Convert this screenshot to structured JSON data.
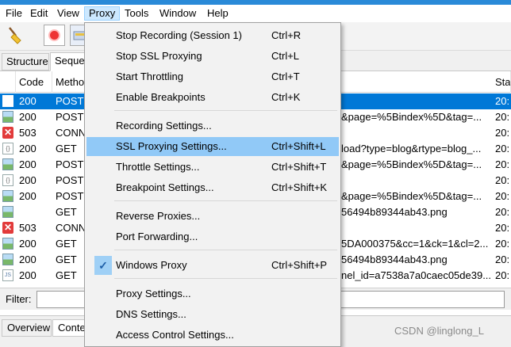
{
  "menubar": [
    "File",
    "Edit",
    "View",
    "Proxy",
    "Tools",
    "Window",
    "Help"
  ],
  "tabs": {
    "structure": "Structure",
    "sequence": "Sequence"
  },
  "columns": {
    "code": "Code",
    "method": "Method",
    "start": "Start"
  },
  "rows": [
    {
      "icon": "document-icon",
      "code": "200",
      "method": "POST",
      "url": "",
      "start": "20:",
      "selected": true
    },
    {
      "icon": "image-icon",
      "code": "200",
      "method": "POST",
      "url": "&page=%5Bindex%5D&tag=...",
      "start": "20:"
    },
    {
      "icon": "error-icon",
      "code": "503",
      "method": "CONNECT",
      "url": "",
      "start": "20:"
    },
    {
      "icon": "json-icon",
      "code": "200",
      "method": "GET",
      "url": "load?type=blog&rtype=blog_...",
      "start": "20:"
    },
    {
      "icon": "image-icon",
      "code": "200",
      "method": "POST",
      "url": "&page=%5Bindex%5D&tag=...",
      "start": "20:"
    },
    {
      "icon": "json-icon",
      "code": "200",
      "method": "POST",
      "url": "",
      "start": "20:"
    },
    {
      "icon": "image-icon",
      "code": "200",
      "method": "POST",
      "url": "&page=%5Bindex%5D&tag=...",
      "start": "20:"
    },
    {
      "icon": "image-icon",
      "code": "",
      "method": "GET",
      "url": "56494b89344ab43.png",
      "start": "20:"
    },
    {
      "icon": "error-icon",
      "code": "503",
      "method": "CONNECT",
      "url": "",
      "start": "20:"
    },
    {
      "icon": "image-icon",
      "code": "200",
      "method": "GET",
      "url": "5DA000375&cc=1&ck=1&cl=2...",
      "start": "20:"
    },
    {
      "icon": "image-icon",
      "code": "200",
      "method": "GET",
      "url": "56494b89344ab43.png",
      "start": "20:"
    },
    {
      "icon": "js-icon",
      "code": "200",
      "method": "GET",
      "url": "nel_id=a7538a7a0caec05de39...",
      "start": "20:"
    }
  ],
  "filter": {
    "label": "Filter:"
  },
  "bottom_tabs": {
    "overview": "Overview",
    "contents": "Contents"
  },
  "watermark": "CSDN @linglong_L",
  "proxy_menu": [
    {
      "label": "Stop Recording (Session 1)",
      "shortcut": "Ctrl+R"
    },
    {
      "label": "Stop SSL Proxying",
      "shortcut": "Ctrl+L"
    },
    {
      "label": "Start Throttling",
      "shortcut": "Ctrl+T"
    },
    {
      "label": "Enable Breakpoints",
      "shortcut": "Ctrl+K"
    },
    {
      "label": "Recording Settings...",
      "shortcut": ""
    },
    {
      "label": "SSL Proxying Settings...",
      "shortcut": "Ctrl+Shift+L",
      "highlighted": true
    },
    {
      "label": "Throttle Settings...",
      "shortcut": "Ctrl+Shift+T"
    },
    {
      "label": "Breakpoint Settings...",
      "shortcut": "Ctrl+Shift+K"
    },
    {
      "label": "Reverse Proxies...",
      "shortcut": ""
    },
    {
      "label": "Port Forwarding...",
      "shortcut": ""
    },
    {
      "label": "Windows Proxy",
      "shortcut": "Ctrl+Shift+P",
      "checked": true
    },
    {
      "label": "Proxy Settings...",
      "shortcut": ""
    },
    {
      "label": "DNS Settings...",
      "shortcut": ""
    },
    {
      "label": "Access Control Settings...",
      "shortcut": ""
    }
  ],
  "colors": {
    "accent": "#0078d7",
    "menu_highlight": "#91c9f7",
    "error": "#e23b3b"
  }
}
